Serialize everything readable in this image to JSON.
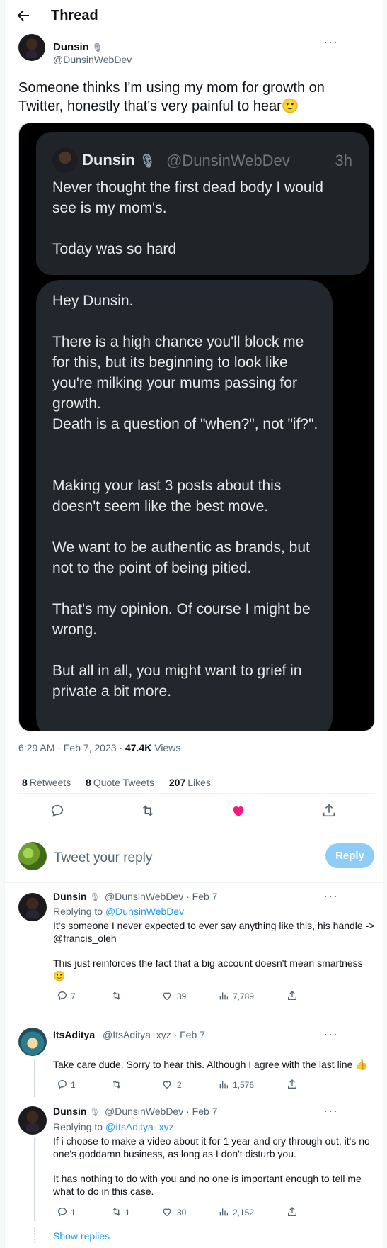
{
  "header": {
    "title": "Thread"
  },
  "main_tweet": {
    "name": "Dunsin",
    "handle": "@DunsinWebDev",
    "text": "Someone thinks I'm using my mom for growth on Twitter, honestly that's very painful to hear🙂",
    "quoted": {
      "name": "Dunsin",
      "handle": "@DunsinWebDev",
      "time": "3h",
      "line1": "Never thought the first dead body I would see is my mom's.",
      "line2": "Today was so hard"
    },
    "message": [
      "Hey Dunsin.",
      "There is a high chance you'll block me for this, but its beginning to look like you're milking your mums passing for growth.",
      "Death is a question of \"when?\", not \"if?\".",
      "Making your last 3 posts about this doesn't seem like the best move.",
      "We want to be authentic as brands, but not to the point of being pitied.",
      "That's my opinion. Of course I might be wrong.",
      "But all in all, you might want to grief in private a bit more."
    ],
    "timestamp": "6:29 AM · Feb 7, 2023 · ",
    "views_count": "47.4K",
    "views_label": " Views",
    "retweets": "8",
    "retweets_label": "Retweets",
    "quotes": "8",
    "quotes_label": "Quote Tweets",
    "likes": "207",
    "likes_label": "Likes"
  },
  "reply_box": {
    "placeholder": "Tweet your reply",
    "button": "Reply"
  },
  "replies": [
    {
      "name": "Dunsin",
      "handle": "@DunsinWebDev · Feb 7",
      "replying_prefix": "Replying to ",
      "replying_to": "@DunsinWebDev",
      "text1": "It's someone I never expected to ever say anything like this, his handle -> @francis_oleh",
      "text2": "This just reinforces the fact that a big account doesn't mean smartness 🙂",
      "replies": "7",
      "retweets": "",
      "likes": "39",
      "views": "7,789"
    },
    {
      "name": "ItsAditya",
      "handle": "@ItsAditya_xyz · Feb 7",
      "text1": "Take care dude. Sorry to hear this. Although I agree with the last line 👍",
      "replies": "1",
      "retweets": "",
      "likes": "2",
      "views": "1,576"
    },
    {
      "name": "Dunsin",
      "handle": "@DunsinWebDev · Feb 7",
      "replying_prefix": "Replying to ",
      "replying_to": "@ItsAditya_xyz",
      "text1": "If i choose to make a video about it for 1 year and cry through out, it's no one's goddamn business, as long as I don't disturb you.",
      "text2": "It has nothing to do with you and no one is important enough to tell me what to do in this case.",
      "replies": "1",
      "retweets": "1",
      "likes": "30",
      "views": "2,152"
    }
  ],
  "show_replies": "Show replies",
  "colors": {
    "accent": "#1d9bf0",
    "like": "#f91880",
    "muted": "#536471"
  }
}
